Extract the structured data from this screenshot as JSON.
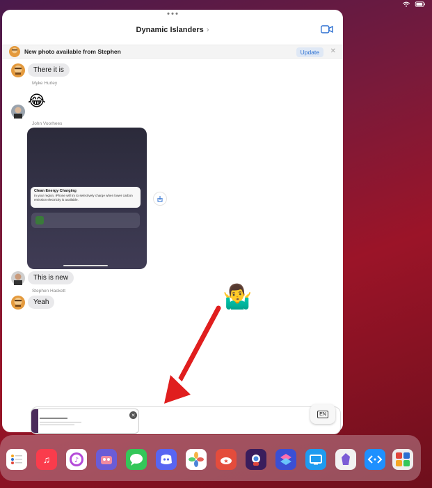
{
  "window": {
    "title": "Dynamic Islanders",
    "chevron": "›"
  },
  "banner": {
    "text": "New photo available from Stephen",
    "update_label": "Update",
    "close": "✕"
  },
  "messages": [
    {
      "type": "text",
      "text": "There it is"
    },
    {
      "type": "sender",
      "text": "Myke Hurley"
    },
    {
      "type": "emoji",
      "text": "😂"
    },
    {
      "type": "sender",
      "text": "John Voorhees"
    },
    {
      "type": "image"
    },
    {
      "type": "text",
      "text": "This is new"
    },
    {
      "type": "sender",
      "text": "Stephen Hackett"
    },
    {
      "type": "text",
      "text": "Yeah"
    }
  ],
  "screenshot": {
    "notification_title": "Clean Energy Charging",
    "notification_body": "In your region, iPhone will try to selectively charge when lower carbon emission electricity is available."
  },
  "reaction_emoji": "🤷‍♂️",
  "input": {
    "keyboard_label": "EN"
  },
  "dock": {
    "apps": [
      {
        "name": "reminders",
        "color": "#ffffff"
      },
      {
        "name": "music",
        "color": "#fa3c4c"
      },
      {
        "name": "itunes-store",
        "color": "#ffffff"
      },
      {
        "name": "game-app",
        "color": "#6b5cd6"
      },
      {
        "name": "messages",
        "color": "#34c759"
      },
      {
        "name": "discord",
        "color": "#5865f2"
      },
      {
        "name": "photos",
        "color": "#ffffff"
      },
      {
        "name": "cloud-app",
        "color": "#e44c3c"
      },
      {
        "name": "astronaut-app",
        "color": "#3a1d5c"
      },
      {
        "name": "shortcuts",
        "color": "#3b4fd4"
      },
      {
        "name": "screens",
        "color": "#1e9bf0"
      },
      {
        "name": "obsidian",
        "color": "#f2f2f2"
      },
      {
        "name": "remote-app",
        "color": "#1e90ff"
      },
      {
        "name": "app-library",
        "color": "#eeeeee"
      }
    ]
  }
}
